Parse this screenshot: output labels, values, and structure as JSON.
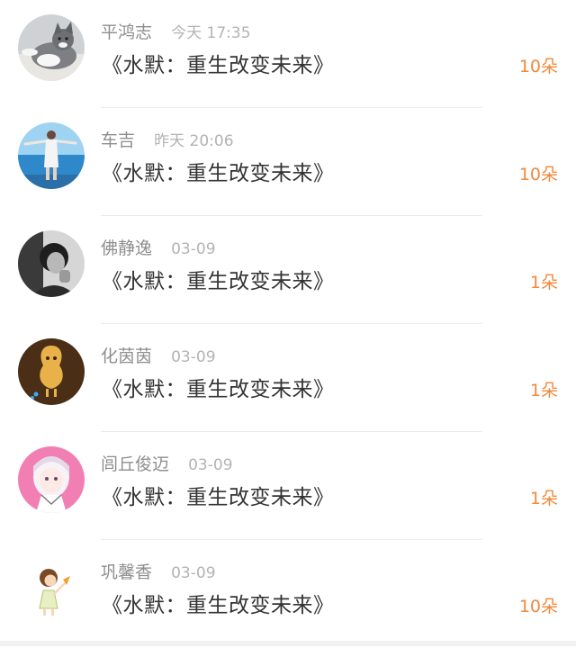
{
  "accent_color": "#f08a3c",
  "gifts": [
    {
      "user": "平鸿志",
      "time": "今天 17:35",
      "title": "《水默：重生改变未来》",
      "count": "10朵",
      "avatar_icon": "cat-photo-avatar-icon"
    },
    {
      "user": "车吉",
      "time": "昨天 20:06",
      "title": "《水默：重生改变未来》",
      "count": "10朵",
      "avatar_icon": "sea-photo-avatar-icon"
    },
    {
      "user": "佛静逸",
      "time": "03-09",
      "title": "《水默：重生改变未来》",
      "count": "1朵",
      "avatar_icon": "bw-person-avatar-icon"
    },
    {
      "user": "化茵茵",
      "time": "03-09",
      "title": "《水默：重生改变未来》",
      "count": "1朵",
      "avatar_icon": "peanut-avatar-icon"
    },
    {
      "user": "闾丘俊迈",
      "time": "03-09",
      "title": "《水默：重生改变未来》",
      "count": "1朵",
      "avatar_icon": "anime-girl-avatar-icon"
    },
    {
      "user": "巩馨香",
      "time": "03-09",
      "title": "《水默：重生改变未来》",
      "count": "10朵",
      "avatar_icon": "cartoon-girl-avatar-icon"
    }
  ]
}
